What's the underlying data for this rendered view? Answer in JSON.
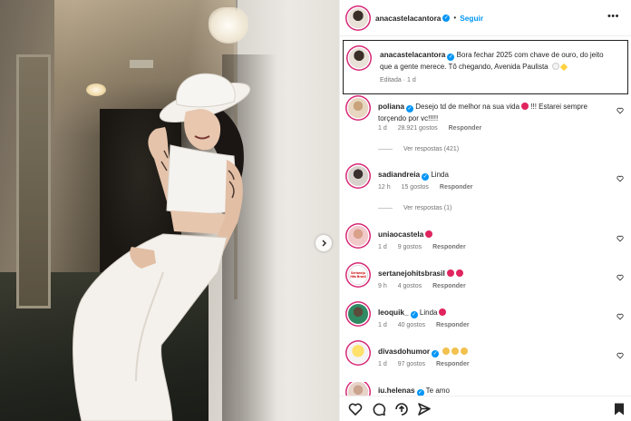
{
  "post": {
    "author": "anacastelacantora",
    "follow_label": "Seguir",
    "more_label": "•••",
    "caption_text": "Bora fechar 2025 com chave de ouro, do jeito que a gente merece. Tô chegando, Avenida Paulista",
    "caption_edited": "Editada",
    "caption_time": "1 d"
  },
  "comments": [
    {
      "user": "poliana",
      "verified": true,
      "text": "Desejo td de melhor na sua vida",
      "text2": "!!! Estarei sempre torçendo por vc!!!!!",
      "time": "1 d",
      "likes": "28.921 gostos",
      "reply": "Responder",
      "replies": "Ver respostas (421)"
    },
    {
      "user": "sadiandreia",
      "verified": true,
      "text": "Linda",
      "time": "12 h",
      "likes": "15 gostos",
      "reply": "Responder",
      "replies": "Ver respostas (1)"
    },
    {
      "user": "uniaocastela",
      "verified": false,
      "text": "",
      "time": "1 d",
      "likes": "9 gostos",
      "reply": "Responder"
    },
    {
      "user": "sertanejohitsbrasil",
      "verified": false,
      "text": "",
      "time": "9 h",
      "likes": "4 gostos",
      "reply": "Responder"
    },
    {
      "user": "leoquik_",
      "verified": true,
      "text": "Linda",
      "time": "1 d",
      "likes": "40 gostos",
      "reply": "Responder"
    },
    {
      "user": "divasdohumor",
      "verified": true,
      "text": "",
      "time": "1 d",
      "likes": "97 gostos",
      "reply": "Responder"
    },
    {
      "user": "iu.helenas",
      "verified": true,
      "text": "Te amo"
    }
  ],
  "avatar_logo_text": "Sertanejo Hits Brasil",
  "colors": {
    "accent": "#0095f6",
    "ring": "#d62976",
    "text": "#262626",
    "muted": "#737373"
  },
  "icons": [
    "heart-icon",
    "comment-icon",
    "share-icon",
    "send-icon",
    "bookmark-icon",
    "chevron-right-icon"
  ]
}
